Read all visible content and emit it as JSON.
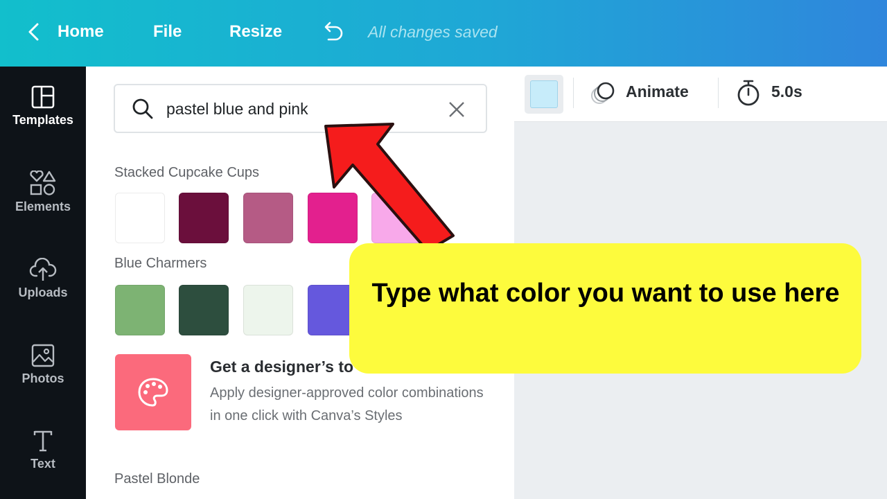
{
  "topbar": {
    "home": "Home",
    "file": "File",
    "resize": "Resize",
    "status": "All changes saved"
  },
  "rail": [
    {
      "label": "Templates",
      "icon": "templates-icon"
    },
    {
      "label": "Elements",
      "icon": "elements-icon"
    },
    {
      "label": "Uploads",
      "icon": "uploads-icon"
    },
    {
      "label": "Photos",
      "icon": "photos-icon"
    },
    {
      "label": "Text",
      "icon": "text-icon"
    }
  ],
  "search": {
    "value": "pastel blue and pink"
  },
  "palettes": [
    {
      "name": "Stacked Cupcake Cups",
      "colors": [
        "#ffffff",
        "#6b0f3c",
        "#b55b85",
        "#e3208e",
        "#f8a9ea"
      ]
    },
    {
      "name": "Blue Charmers",
      "colors": [
        "#7db373",
        "#2d4e3e",
        "#edf5ec",
        "#6558dd"
      ]
    },
    {
      "name": "Pastel Blonde",
      "colors": []
    }
  ],
  "tip": {
    "title": "Get a designer’s to",
    "body": "Apply designer-approved color combinations in one click with Canva’s Styles"
  },
  "toolbar": {
    "animate": "Animate",
    "duration": "5.0s",
    "selected_color": "#c7ecfa"
  },
  "callout": {
    "text": "Type what color you want to use here"
  },
  "colors": {
    "topbar_start": "#12bfcc",
    "topbar_end": "#2f86dc",
    "rail_bg": "#0e1318",
    "callout_bg": "#fdfb3d",
    "arrow": "#f51c1c"
  }
}
